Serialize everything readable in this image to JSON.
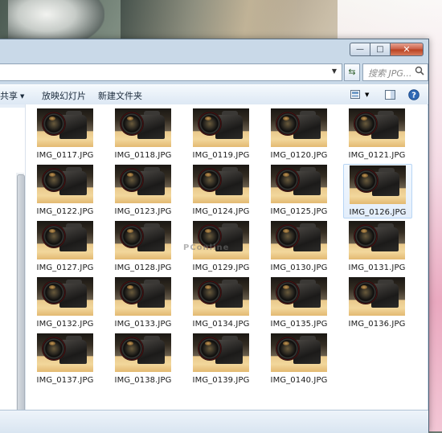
{
  "window": {
    "caption_buttons": {
      "minimize": "—",
      "maximize": "□",
      "close": "✕"
    }
  },
  "addressbar": {
    "search_placeholder": "搜索 JPG...",
    "icons": [
      "dropdown-arrow-icon",
      "refresh-icon",
      "search-icon"
    ]
  },
  "toolbar": {
    "share_label": "共享",
    "slideshow_label": "放映幻灯片",
    "new_folder_label": "新建文件夹",
    "icons": [
      "view-options-icon",
      "preview-pane-icon",
      "help-icon"
    ]
  },
  "files": [
    {
      "name": "IMG_0117.JPG"
    },
    {
      "name": "IMG_0118.JPG"
    },
    {
      "name": "IMG_0119.JPG"
    },
    {
      "name": "IMG_0120.JPG"
    },
    {
      "name": "IMG_0121.JPG"
    },
    {
      "name": "IMG_0122.JPG"
    },
    {
      "name": "IMG_0123.JPG"
    },
    {
      "name": "IMG_0124.JPG"
    },
    {
      "name": "IMG_0125.JPG"
    },
    {
      "name": "IMG_0126.JPG",
      "selected": true
    },
    {
      "name": "IMG_0127.JPG"
    },
    {
      "name": "IMG_0128.JPG"
    },
    {
      "name": "IMG_0129.JPG"
    },
    {
      "name": "IMG_0130.JPG"
    },
    {
      "name": "IMG_0131.JPG"
    },
    {
      "name": "IMG_0132.JPG"
    },
    {
      "name": "IMG_0133.JPG"
    },
    {
      "name": "IMG_0134.JPG"
    },
    {
      "name": "IMG_0135.JPG"
    },
    {
      "name": "IMG_0136.JPG"
    },
    {
      "name": "IMG_0137.JPG"
    },
    {
      "name": "IMG_0138.JPG"
    },
    {
      "name": "IMG_0139.JPG"
    },
    {
      "name": "IMG_0140.JPG"
    }
  ],
  "watermark": "PConline",
  "colors": {
    "selection_border": "#b8d6f5",
    "toolbar_text": "#1b2b3c"
  }
}
